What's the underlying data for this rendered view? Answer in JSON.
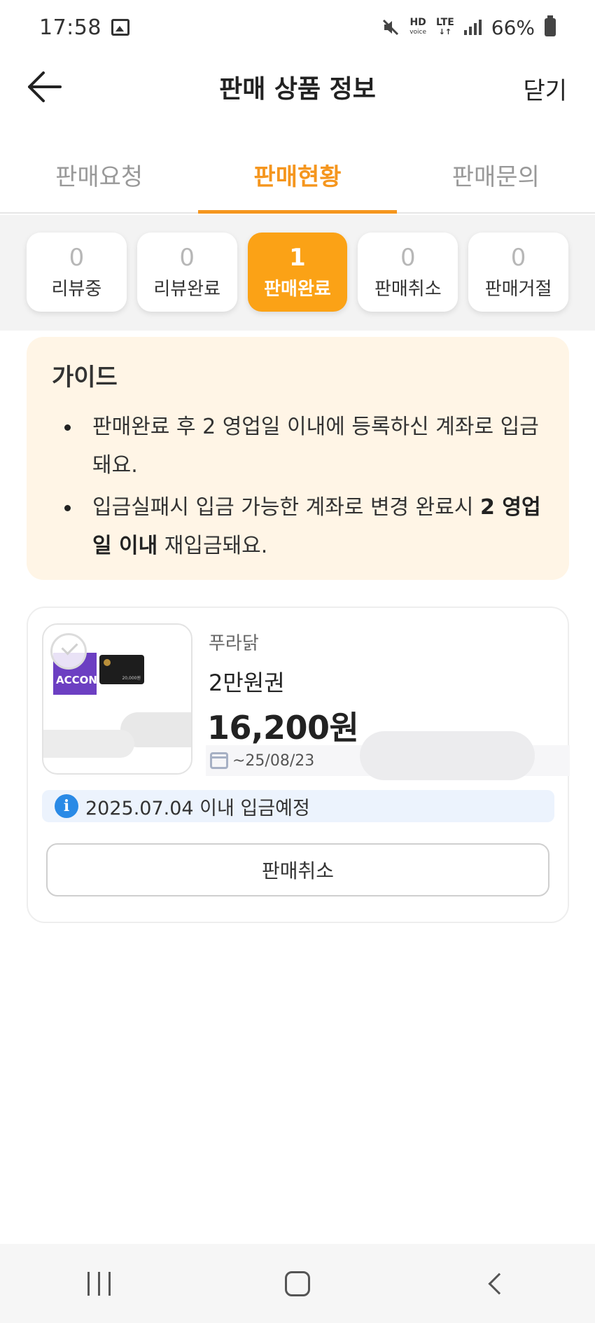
{
  "status_bar": {
    "time": "17:58",
    "hd_label": "HD",
    "hd_sub": "voice",
    "lte_label": "LTE",
    "battery": "66%"
  },
  "header": {
    "title": "판매 상품 정보",
    "close_label": "닫기"
  },
  "tabs": [
    {
      "label": "판매요청",
      "active": false
    },
    {
      "label": "판매현황",
      "active": true
    },
    {
      "label": "판매문의",
      "active": false
    }
  ],
  "filters": [
    {
      "count": "0",
      "label": "리뷰중"
    },
    {
      "count": "0",
      "label": "리뷰완료"
    },
    {
      "count": "1",
      "label": "판매완료"
    },
    {
      "count": "0",
      "label": "판매취소"
    },
    {
      "count": "0",
      "label": "판매거절"
    }
  ],
  "guide": {
    "title": "가이드",
    "item1": "판매완료 후 2 영업일 이내에 등록하신 계좌로 입금돼요.",
    "item2_pre": "입금실패시 입금 가능한 계좌로 변경 완료시 ",
    "item2_bold": "2 영업일 이내",
    "item2_post": " 재입금돼요."
  },
  "product": {
    "thumb_text": "ACCON",
    "thumb_value": "20,000원",
    "brand": "푸라닭",
    "name": "2만원권",
    "price": "16,200원",
    "expiry": "~25/08/23",
    "deposit_notice": "2025.07.04 이내 입금예정",
    "cancel_label": "판매취소"
  },
  "colors": {
    "accent": "#f5961e",
    "active_filter": "#fba216",
    "guide_bg": "#fff5e6",
    "info_blue": "#2a8ae6"
  },
  "icons": [
    "back-arrow-icon",
    "image-icon",
    "mute-icon",
    "signal-icon",
    "battery-icon",
    "calendar-icon",
    "info-icon",
    "check-icon",
    "recents-icon",
    "home-icon",
    "nav-back-icon"
  ]
}
